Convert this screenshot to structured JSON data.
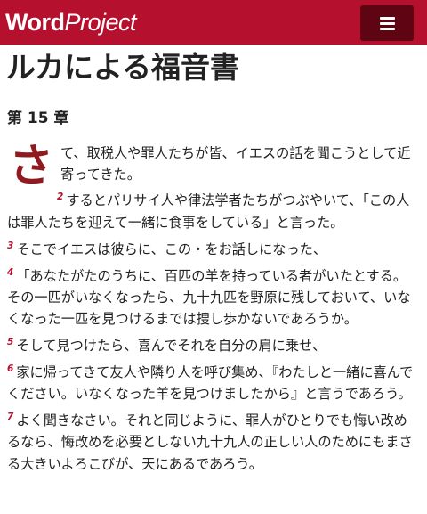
{
  "header": {
    "logo_word": "Word",
    "logo_project": "Project",
    "menu_icon": "hamburger-menu-icon",
    "brand_color": "#b5102d"
  },
  "book_title": "ルカによる福音書",
  "chapter_heading": "第 15 章",
  "verses": [
    {
      "dropcap": "さ",
      "text": "て、取税人や罪人たちが皆、イエスの話を聞こうとして近寄ってきた。"
    },
    {
      "number": "2",
      "text": "するとパリサイ人や律法学者たちがつぶやいて、「この人は罪人たちを迎えて一緒に食事をしている」と言った。"
    },
    {
      "number": "3",
      "text": "そこでイエスは彼らに、この・をお話しになった、"
    },
    {
      "number": "4",
      "text": "「あなたがたのうちに、百匹の羊を持っている者がいたとする。その一匹がいなくなったら、九十九匹を野原に残しておいて、いなくなった一匹を見つけるまでは捜し歩かないであろうか。"
    },
    {
      "number": "5",
      "text": "そして見つけたら、喜んでそれを自分の肩に乗せ、"
    },
    {
      "number": "6",
      "text": "家に帰ってきて友人や隣り人を呼び集め、『わたしと一緒に喜んでください。いなくなった羊を見つけましたから』と言うであろう。"
    },
    {
      "number": "7",
      "text": "よく聞きなさい。それと同じように、罪人がひとりでも悔い改めるなら、悔改めを必要としない九十九人の正しい人のためにもまさる大きいよろこびが、天にあるであろう。"
    }
  ]
}
